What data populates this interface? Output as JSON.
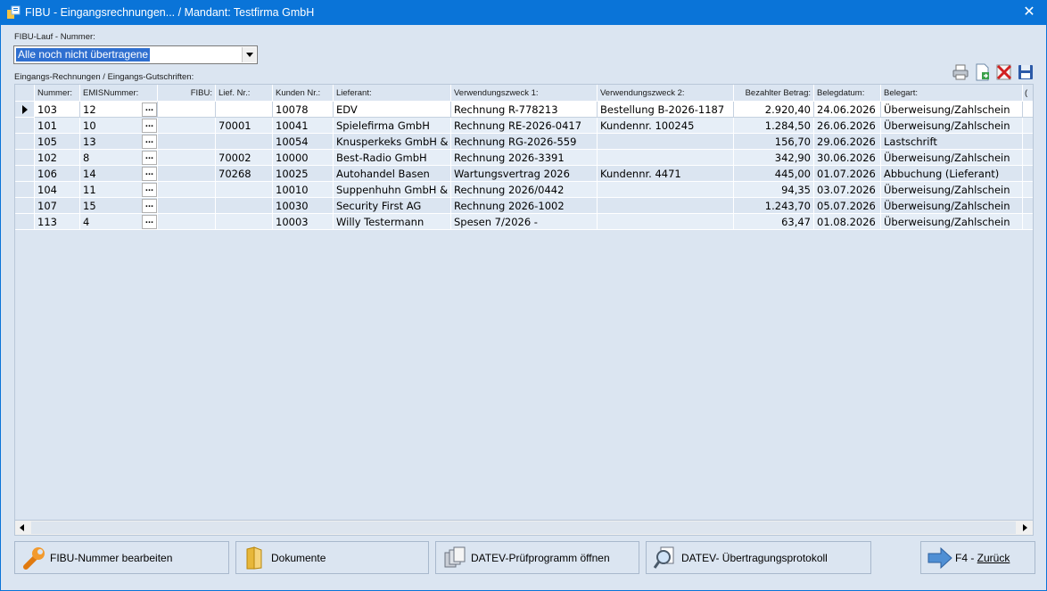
{
  "window": {
    "title": "FIBU - Eingangsrechnungen... / Mandant: Testfirma GmbH",
    "close_label": "✕"
  },
  "lauf": {
    "label": "FIBU-Lauf - Nummer:",
    "selected": "Alle noch nicht übertragene"
  },
  "section_label": "Eingangs-Rechnungen / Eingangs-Gutschriften:",
  "toolbar_icons": [
    "printer-icon",
    "export-document-icon",
    "delete-icon",
    "save-icon"
  ],
  "table": {
    "columns": [
      "Nummer:",
      "EMISNummer:",
      "FIBU:",
      "Lief. Nr.:",
      "Kunden Nr.:",
      "Lieferant:",
      "Verwendungszweck 1:",
      "Verwendungszweck 2:",
      "Bezahlter Betrag:",
      "Belegdatum:",
      "Belegart:",
      "("
    ],
    "rows": [
      {
        "nummer": "103",
        "emis": "12",
        "fibu": "",
        "lief": "",
        "kunden": "10078",
        "lieferant": "EDV",
        "zweck1": "Rechnung R-778213",
        "zweck2": "Bestellung B-2026-1187",
        "betrag": "2.920,40",
        "datum": "24.06.2026",
        "art": "Überweisung/Zahlschein"
      },
      {
        "nummer": "101",
        "emis": "10",
        "fibu": "",
        "lief": "70001",
        "kunden": "10041",
        "lieferant": "Spielefirma GmbH",
        "zweck1": "Rechnung RE-2026-0417",
        "zweck2": "Kundennr. 100245",
        "betrag": "1.284,50",
        "datum": "26.06.2026",
        "art": "Überweisung/Zahlschein"
      },
      {
        "nummer": "105",
        "emis": "13",
        "fibu": "",
        "lief": "",
        "kunden": "10054",
        "lieferant": "Knusperkeks GmbH &",
        "zweck1": "Rechnung RG-2026-559",
        "zweck2": "",
        "betrag": "156,70",
        "datum": "29.06.2026",
        "art": "Lastschrift"
      },
      {
        "nummer": "102",
        "emis": "8",
        "fibu": "",
        "lief": "70002",
        "kunden": "10000",
        "lieferant": "Best-Radio GmbH",
        "zweck1": "Rechnung 2026-3391",
        "zweck2": "",
        "betrag": "342,90",
        "datum": "30.06.2026",
        "art": "Überweisung/Zahlschein"
      },
      {
        "nummer": "106",
        "emis": "14",
        "fibu": "",
        "lief": "70268",
        "kunden": "10025",
        "lieferant": "Autohandel Basen",
        "zweck1": "Wartungsvertrag 2026",
        "zweck2": "Kundennr. 4471",
        "betrag": "445,00",
        "datum": "01.07.2026",
        "art": "Abbuchung (Lieferant)"
      },
      {
        "nummer": "104",
        "emis": "11",
        "fibu": "",
        "lief": "",
        "kunden": "10010",
        "lieferant": "Suppenhuhn GmbH &",
        "zweck1": "Rechnung 2026/0442",
        "zweck2": "",
        "betrag": "94,35",
        "datum": "03.07.2026",
        "art": "Überweisung/Zahlschein"
      },
      {
        "nummer": "107",
        "emis": "15",
        "fibu": "",
        "lief": "",
        "kunden": "10030",
        "lieferant": "Security First AG",
        "zweck1": "Rechnung 2026-1002",
        "zweck2": "",
        "betrag": "1.243,70",
        "datum": "05.07.2026",
        "art": "Überweisung/Zahlschein"
      },
      {
        "nummer": "113",
        "emis": "4",
        "fibu": "",
        "lief": "",
        "kunden": "10003",
        "lieferant": "Willy Testermann",
        "zweck1": "Spesen 7/2026 -",
        "zweck2": "",
        "betrag": "63,47",
        "datum": "01.08.2026",
        "art": "Überweisung/Zahlschein"
      }
    ],
    "ellipsis": "..."
  },
  "buttons": {
    "fibu_edit": "FIBU-Nummer bearbeiten",
    "dokumente": "Dokumente",
    "datev_pruef": "DATEV-Prüfprogramm öffnen",
    "datev_protokoll": "DATEV- Übertragungsprotokoll",
    "zurueck_key": "F4 - ",
    "zurueck_label": "Zurück"
  },
  "colors": {
    "titlebar": "#0a74d8",
    "background": "#dbe5f1",
    "selection": "#2f6fd0"
  }
}
